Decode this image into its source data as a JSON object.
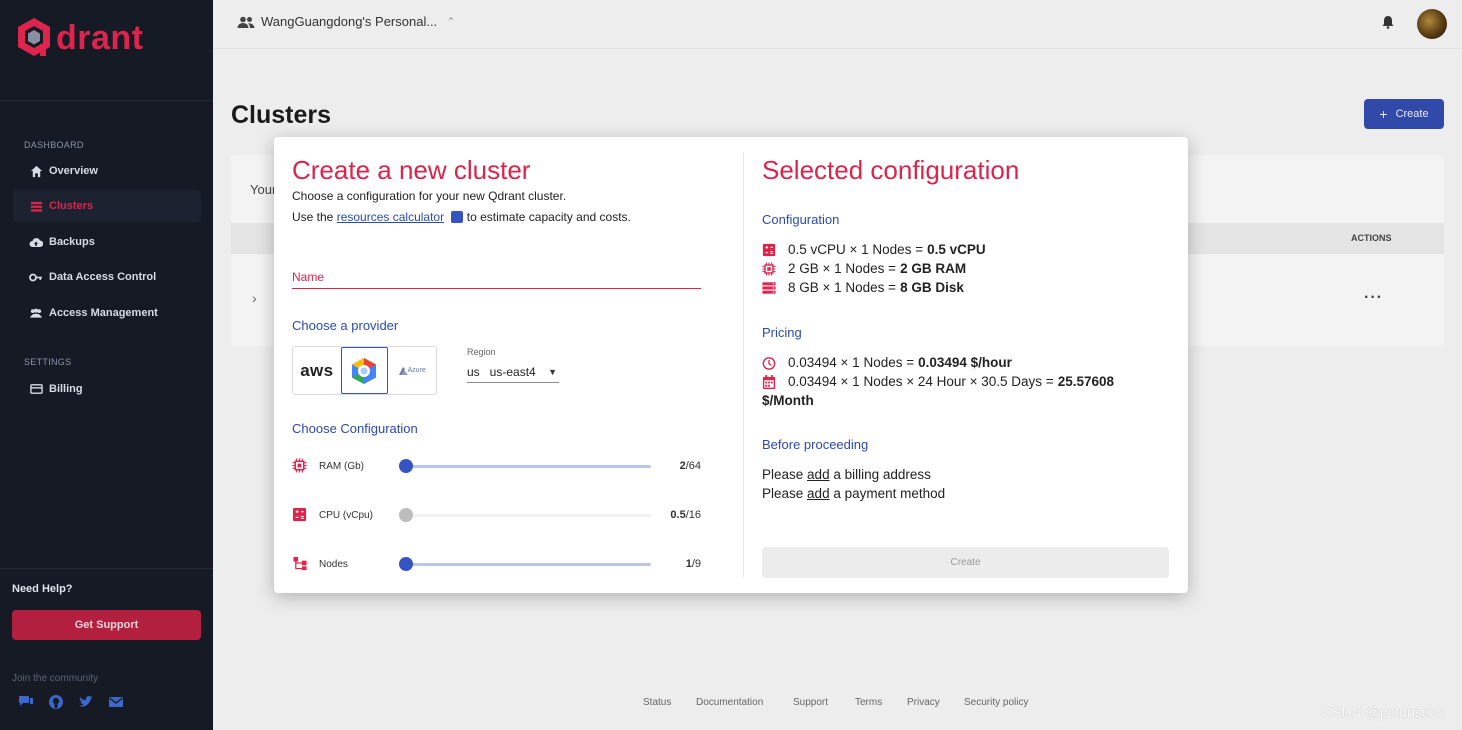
{
  "sidebar": {
    "logo_text": "drant",
    "section_dashboard": "DASHBOARD",
    "section_settings": "SETTINGS",
    "items": [
      {
        "label": "Overview",
        "icon": "home-icon"
      },
      {
        "label": "Clusters",
        "icon": "list-icon",
        "active": true
      },
      {
        "label": "Backups",
        "icon": "cloud-upload-icon"
      },
      {
        "label": "Data Access Control",
        "icon": "key-icon"
      },
      {
        "label": "Access Management",
        "icon": "people-icon"
      }
    ],
    "billing_label": "Billing",
    "need_help": "Need Help?",
    "support_button": "Get Support",
    "community": "Join the community",
    "social_icons": [
      "chat-icon",
      "github-icon",
      "twitter-icon",
      "mail-icon"
    ]
  },
  "topbar": {
    "workspace": "WangGuangdong's Personal..."
  },
  "page": {
    "title": "Clusters",
    "create_button": "Create",
    "card_text": "Your",
    "actions_header": "ACTIONS",
    "row_more": "···"
  },
  "modal": {
    "title": "Create a new cluster",
    "subtitle": "Choose a configuration for your new Qdrant cluster.",
    "calc_prefix": "Use the",
    "calc_link": "resources calculator",
    "calc_suffix": "to estimate capacity and costs.",
    "name_placeholder": "Name",
    "provider_heading": "Choose a provider",
    "providers": [
      "aws",
      "gcp",
      "Azure"
    ],
    "selected_provider": "gcp",
    "region_label": "Region",
    "region_value": "us   us-east4",
    "config_heading": "Choose Configuration",
    "sliders": [
      {
        "label": "RAM (Gb)",
        "current": "2",
        "max": "/64",
        "fraction": 0.0
      },
      {
        "label": "CPU (vCpu)",
        "current": "0.5",
        "max": "/16",
        "fraction": 0.0,
        "disabled": true
      },
      {
        "label": "Nodes",
        "current": "1",
        "max": "/9",
        "fraction": 0.0
      }
    ],
    "selected_title": "Selected configuration",
    "configuration_heading": "Configuration",
    "config_lines": [
      {
        "text": "0.5 vCPU × 1 Nodes =",
        "bold": "0.5 vCPU"
      },
      {
        "text": "2 GB × 1 Nodes =",
        "bold": "2 GB RAM"
      },
      {
        "text": "8 GB × 1 Nodes =",
        "bold": "8 GB Disk"
      }
    ],
    "pricing_heading": "Pricing",
    "pricing_hour_text": "0.03494 × 1 Nodes =",
    "pricing_hour_bold": "0.03494 $/hour",
    "pricing_month_text": "0.03494 × 1 Nodes × 24 Hour × 30.5 Days =",
    "pricing_month_bold_1": "25.57608",
    "pricing_month_bold_2": "$/Month",
    "before_heading": "Before proceeding",
    "please": "Please",
    "add_link": "add",
    "billing_note": "a billing address",
    "payment_note": "a payment method",
    "create_button": "Create"
  },
  "footer": {
    "links": [
      "Status",
      "Documentation",
      "Support",
      "Terms",
      "Privacy",
      "Security policy"
    ]
  },
  "watermark": "CSDN @petunsecn",
  "colors": {
    "brand_red": "#dc244c",
    "accent_blue": "#2b4ab0",
    "sidebar_bg": "#151a25",
    "button_blue": "#3149a8"
  }
}
